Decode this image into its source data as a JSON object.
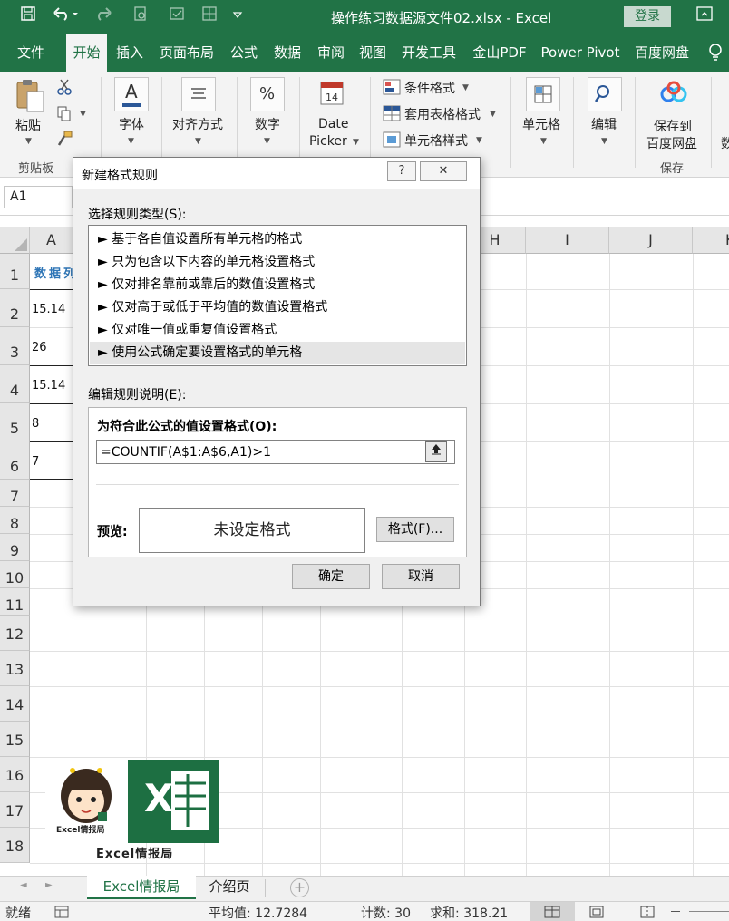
{
  "window": {
    "title": "操作练习数据源文件02.xlsx  -  Excel",
    "login_label": "登录"
  },
  "tabs": [
    "文件",
    "开始",
    "插入",
    "页面布局",
    "公式",
    "数据",
    "审阅",
    "视图",
    "开发工具",
    "金山PDF",
    "Power Pivot",
    "百度网盘"
  ],
  "active_tab": "开始",
  "ribbon": {
    "paste": "粘贴",
    "clipboard_group": "剪贴板",
    "font": "字体",
    "alignment": "对齐方式",
    "number": "数字",
    "date_picker_1": "Date",
    "date_picker_2": "Picker",
    "conditional_format": "条件格式",
    "table_format": "套用表格格式",
    "cell_style": "单元格样式",
    "cells": "单元格",
    "edit": "编辑",
    "save_to_1": "保存到",
    "save_to_2": "百度网盘",
    "save_group": "保存",
    "cut_off_label": "数",
    "number_icon": "%",
    "font_icon": "A",
    "calendar_day": "14"
  },
  "name_box": "A1",
  "columns": [
    "A",
    "H",
    "I",
    "J",
    "K"
  ],
  "rows": [
    "1",
    "2",
    "3",
    "4",
    "5",
    "6",
    "7",
    "8",
    "9",
    "10",
    "11",
    "12",
    "13",
    "14",
    "15",
    "16",
    "17",
    "18"
  ],
  "cells": {
    "A1": "数据列",
    "A2": "15.14",
    "A3": "26",
    "A4": "15.14",
    "A5": "8",
    "A6": "7"
  },
  "logo": {
    "caption": "Excel情报局",
    "mini_caption": "Excel情报局",
    "letter": "X"
  },
  "sheets": [
    "Excel情报局",
    "介绍页"
  ],
  "active_sheet": "Excel情报局",
  "status": {
    "ready": "就绪",
    "average": "平均值: 12.7284",
    "count": "计数: 30",
    "sum": "求和: 318.21"
  },
  "dialog": {
    "title": "新建格式规则",
    "help": "?",
    "close": "✕",
    "rule_type_label": "选择规则类型(S):",
    "rules": [
      "► 基于各自值设置所有单元格的格式",
      "► 只为包含以下内容的单元格设置格式",
      "► 仅对排名靠前或靠后的数值设置格式",
      "► 仅对高于或低于平均值的数值设置格式",
      "► 仅对唯一值或重复值设置格式",
      "► 使用公式确定要设置格式的单元格"
    ],
    "selected_rule": 5,
    "desc_label": "编辑规则说明(E):",
    "formula_label": "为符合此公式的值设置格式(O):",
    "formula": "=COUNTIF(A$1:A$6,A1)>1",
    "preview_label": "预览:",
    "preview_text": "未设定格式",
    "format_button": "格式(F)...",
    "ok": "确定",
    "cancel": "取消"
  },
  "colors": {
    "excel_green": "#217346",
    "header_blue": "#2e75b6"
  }
}
